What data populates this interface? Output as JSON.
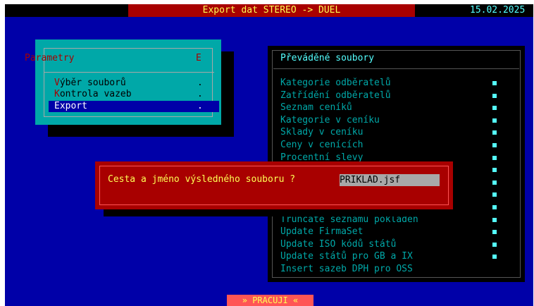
{
  "title_bar": {
    "title": "Export dat STEREO -> DUEL",
    "date": "15.02.2025"
  },
  "menu": {
    "title": "Parametry",
    "title_hotkey": "E",
    "items": [
      {
        "hotkey": "V",
        "rest": "ýběr souborů",
        "dot": ".",
        "selected": false
      },
      {
        "hotkey": "K",
        "rest": "ontrola vazeb",
        "dot": ".",
        "selected": false
      },
      {
        "hotkey": "E",
        "rest": "xport",
        "dot": ".",
        "selected": true
      }
    ]
  },
  "files_panel": {
    "title": "Převáděné soubory",
    "items": [
      {
        "label": "Kategorie odběratelů",
        "marked": true
      },
      {
        "label": "Zatřídění odběratelů",
        "marked": true
      },
      {
        "label": "Seznam ceníků",
        "marked": true
      },
      {
        "label": "Kategorie v ceníku",
        "marked": true
      },
      {
        "label": "Sklady v ceníku",
        "marked": true
      },
      {
        "label": "Ceny v cenících",
        "marked": true
      },
      {
        "label": "Procentní slevy",
        "marked": true
      },
      {
        "label": "",
        "marked": true
      },
      {
        "label": "",
        "marked": true
      },
      {
        "label": "",
        "marked": true
      },
      {
        "label": "",
        "marked": true
      },
      {
        "label": "Truncate seznamu pokladen",
        "marked": true
      },
      {
        "label": "Update FirmaSet",
        "marked": true
      },
      {
        "label": "Update ISO kódů států",
        "marked": true
      },
      {
        "label": "Update států pro GB a IX",
        "marked": true
      },
      {
        "label": "Insert sazeb DPH pro OSS",
        "marked": false
      }
    ]
  },
  "dialog": {
    "prompt": "Cesta a jméno výsledného souboru ?",
    "value": "PRIKLAD.jsf"
  },
  "status": {
    "text": "» PRACUJI «"
  },
  "colors": {
    "background": "#0000a8",
    "accent": "#a80000",
    "panel": "#00a8a8",
    "highlight": "#54ffff",
    "text_yellow": "#ffff54"
  }
}
